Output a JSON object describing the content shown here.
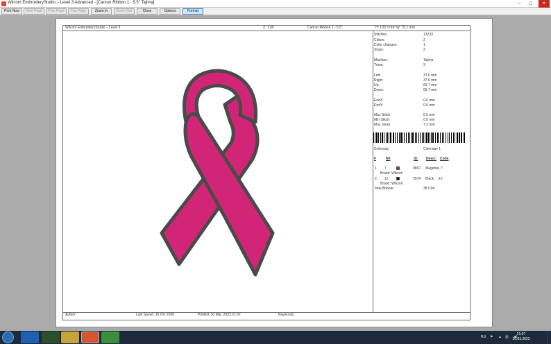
{
  "window": {
    "title": "Wilcom EmbroideryStudio – Level 3 Advanced - [Cancer Ribbon 1 - 5,5\"  Tajima]",
    "minimize_glyph": "–",
    "maximize_glyph": "□",
    "close_glyph": "×"
  },
  "toolbar": {
    "print_now": "Print Now",
    "next_page": "Next Page",
    "prev_page": "Prev Page",
    "two_page": "Two Page",
    "zoom_in": "Zoom In",
    "zoom_out": "Zoom Out",
    "close": "Close",
    "options": "Options",
    "format": "Format"
  },
  "header": {
    "product": "Wilcom EmbroideryStudio – Level 3",
    "zoom": "Z: 1.00",
    "design_name": "Cancer Ribbon 1 - 5,5\"",
    "size": "H: 139.3 mm  W: 75.1 mm"
  },
  "stats": {
    "stitches_label": "Stitches:",
    "stitches_value": "13233",
    "colors_label": "Colors:",
    "colors_value": "2",
    "color_changes_label": "Color changes:",
    "color_changes_value": "1",
    "stops_label": "Stops:",
    "stops_value": "2",
    "machine_label": "Machine:",
    "machine_value": "Tajima",
    "trims_label": "Trims:",
    "trims_value": "3",
    "left_label": "Left:",
    "left_value": "37.6 mm",
    "right_label": "Right:",
    "right_value": "37.6 mm",
    "up_label": "Up:",
    "up_value": "69.7 mm",
    "down_label": "Down:",
    "down_value": "69.7 mm",
    "endx_label": "EndX:",
    "endx_value": "0.0 mm",
    "endy_label": "EndY:",
    "endy_value": "0.0 mm",
    "max_stitch_label": "Max Stitch:",
    "max_stitch_value": "6.9 mm",
    "min_stitch_label": "Min Stitch:",
    "min_stitch_value": "0.5 mm",
    "max_jump_label": "Max Jump:",
    "max_jump_value": "7.2 mm"
  },
  "colorway": {
    "label": "Colorway:",
    "value": "Colorway 1",
    "columns": {
      "num": "#",
      "thread_num": "N#",
      "stitches": "St.",
      "descr": "Descr.",
      "code": "Code"
    },
    "rows": [
      {
        "num": "1.",
        "thread": "7",
        "color": "#c2185b",
        "stitches": "9657",
        "descr": "Magenta",
        "code": "7",
        "brand": "Brand: Wilcom"
      },
      {
        "num": "2.",
        "thread": "13",
        "color": "#111111",
        "stitches": "3574",
        "descr": "Black",
        "code": "13",
        "brand": "Brand: Wilcom"
      }
    ],
    "total_bobbin_label": "Total Bobbin:",
    "total_bobbin_value": "38.01m"
  },
  "footer": {
    "author_label": "Author:",
    "last_saved": "Last Saved: 16 Oct 2020",
    "printed": "Printed: 30 Mar. 2023 21:07",
    "keywords_label": "Keywords:"
  },
  "design": {
    "fill_color": "#d6267a",
    "outline_color": "#4a4a4a"
  },
  "taskbar": {
    "language": "RU",
    "time": "21:07",
    "date": "30.03.2023",
    "apps": [
      "internet-explorer-icon",
      "media-player-icon",
      "file-explorer-icon",
      "wilcom-icon",
      "chrome-icon"
    ]
  }
}
